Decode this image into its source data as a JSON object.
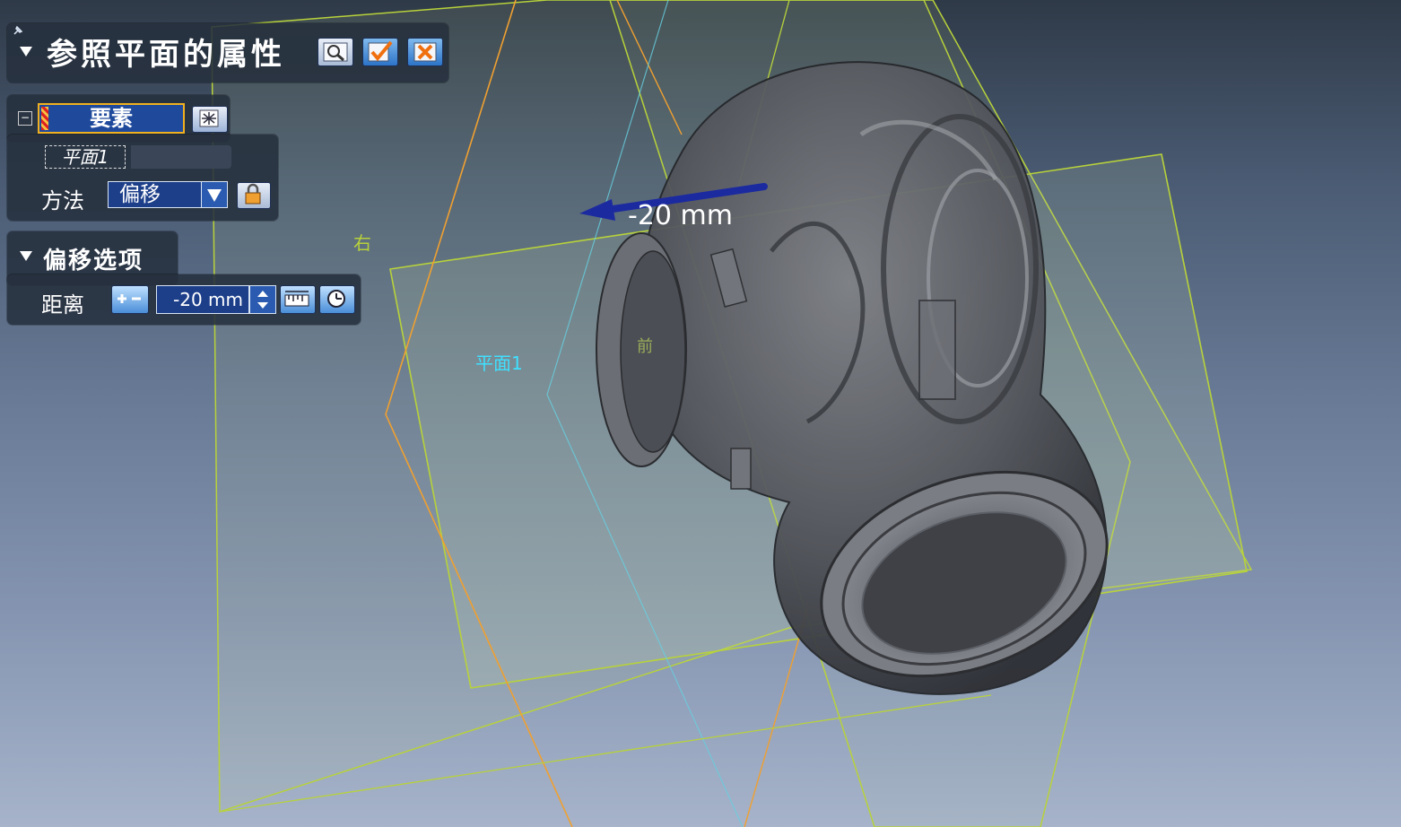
{
  "panel": {
    "title": "参照平面的属性",
    "element_label": "要素",
    "plane_item": "平面1",
    "method_label": "方法",
    "method_value": "偏移",
    "offset_options_title": "偏移选项",
    "distance_label": "距离",
    "distance_value": "-20 mm"
  },
  "viewport": {
    "dimension_label": "-20 mm",
    "plane_label_right": "右",
    "plane_label_new": "平面1",
    "plane_label_front": "前"
  },
  "colors": {
    "panel_bg": "#26303e",
    "field_blue": "#1d3f8a",
    "highlight_border": "#f0b020",
    "plane_green": "#b8d23a",
    "plane_orange": "#f0a030",
    "plane_cyan": "#66d0e0",
    "arrow_blue": "#1c2aa0"
  },
  "icons": [
    "pin-icon",
    "collapse-triangle-icon",
    "preview-icon",
    "check-icon",
    "cancel-x-icon",
    "select-element-icon",
    "dropdown-arrow-icon",
    "lock-icon",
    "flip-direction-icon",
    "spinner-icon",
    "measure-icon",
    "pick-icon"
  ]
}
